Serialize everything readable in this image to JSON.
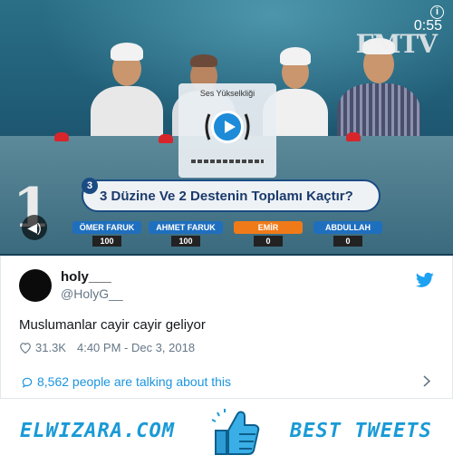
{
  "video": {
    "timer": "0:55",
    "channel_logo": "FMTV",
    "volume_label": "Ses Yükselkliği",
    "question_number": "3",
    "question_text": "3 Düzine Ve 2 Destenin Toplamı Kaçtır?",
    "show_logo": "1",
    "contestants": [
      {
        "name": "ÖMER FARUK",
        "score": "100",
        "color": "#1f6fbf"
      },
      {
        "name": "AHMET FARUK",
        "score": "100",
        "color": "#1f6fbf"
      },
      {
        "name": "EMİR",
        "score": "0",
        "color": "#f07a18"
      },
      {
        "name": "ABDULLAH",
        "score": "0",
        "color": "#1f6fbf"
      }
    ]
  },
  "tweet": {
    "author_name": "holy___",
    "author_handle": "@HolyG__",
    "text": "Muslumanlar cayir cayir geliyor",
    "like_count": "31.3K",
    "timestamp": "4:40 PM - Dec 3, 2018",
    "talking_text": "8,562 people are talking about this"
  },
  "footer": {
    "site": "ELWIZARA.COM",
    "tagline": "BEST TWEETS"
  },
  "colors": {
    "twitter_blue": "#1da1f2",
    "link_blue": "#1b95e0",
    "brand_blue": "#1a9ad6"
  }
}
